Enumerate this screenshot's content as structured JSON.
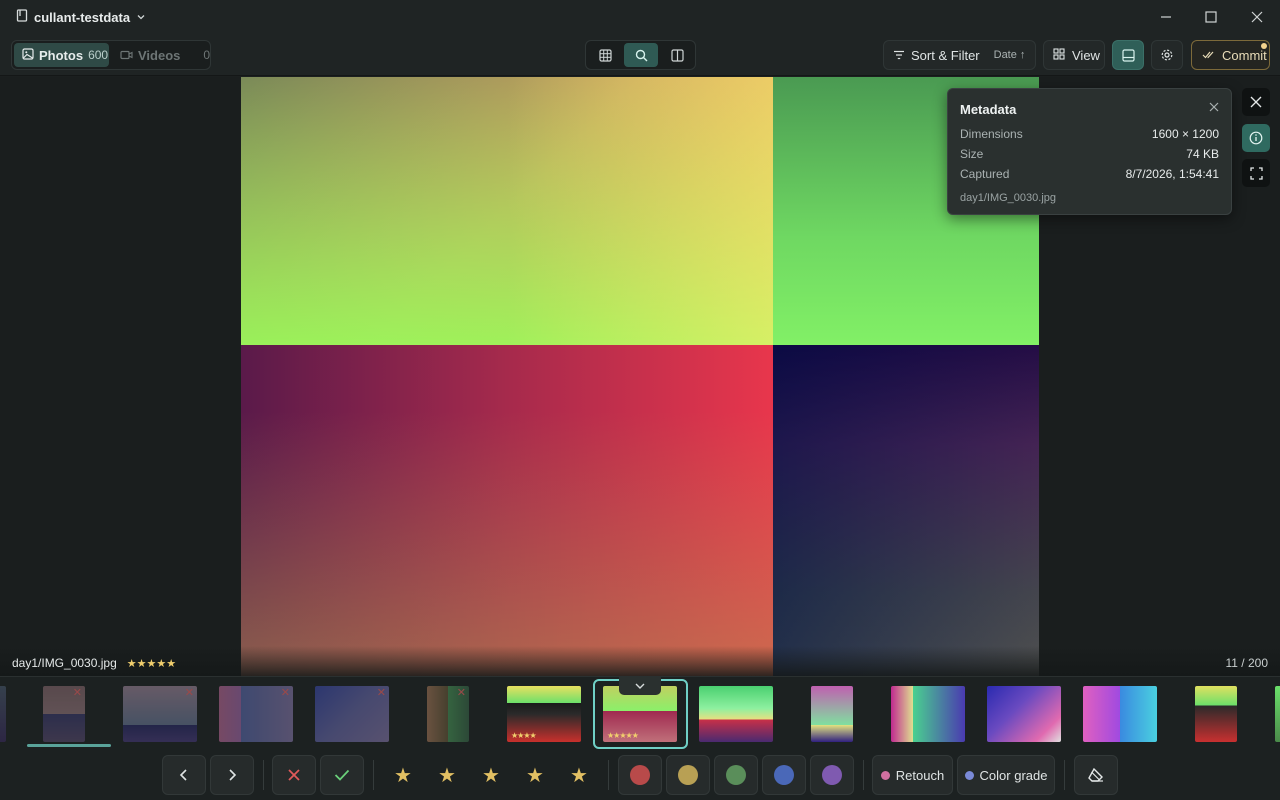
{
  "window": {
    "title": "cullant-testdata"
  },
  "toolbar": {
    "photos_label": "Photos",
    "photos_count": "600",
    "videos_label": "Videos",
    "videos_count": "0",
    "sort_label": "Sort & Filter",
    "sort_value": "Date",
    "view_label": "View",
    "commit_label": "Commit"
  },
  "metadata": {
    "title": "Metadata",
    "rows": [
      {
        "key": "Dimensions",
        "value": "1600 × 1200"
      },
      {
        "key": "Size",
        "value": "74 KB"
      },
      {
        "key": "Captured",
        "value": "8/7/2026, 1:54:41"
      }
    ],
    "path": "day1/IMG_0030.jpg"
  },
  "viewer": {
    "filename": "day1/IMG_0030.jpg",
    "stars": "★★★★★",
    "counter": "11 / 200"
  },
  "filmstrip": {
    "thumb_stars_4": "★★★★",
    "thumb_stars_5": "★★★★★",
    "reject_mark": "✕"
  },
  "actions": {
    "retouch_label": "Retouch",
    "colorgrade_label": "Color grade",
    "colors": {
      "red": "#b84a4a",
      "yellow": "#b8a054",
      "green": "#5a8e5a",
      "blue": "#4a68b8",
      "purple": "#7f5ab0",
      "retouch_dot": "#d070a0",
      "colorgrade_dot": "#7a8ad8"
    }
  },
  "theme": {
    "accent": "#2f5a54",
    "selection": "#6fd0c6",
    "star": "#e2c063"
  }
}
